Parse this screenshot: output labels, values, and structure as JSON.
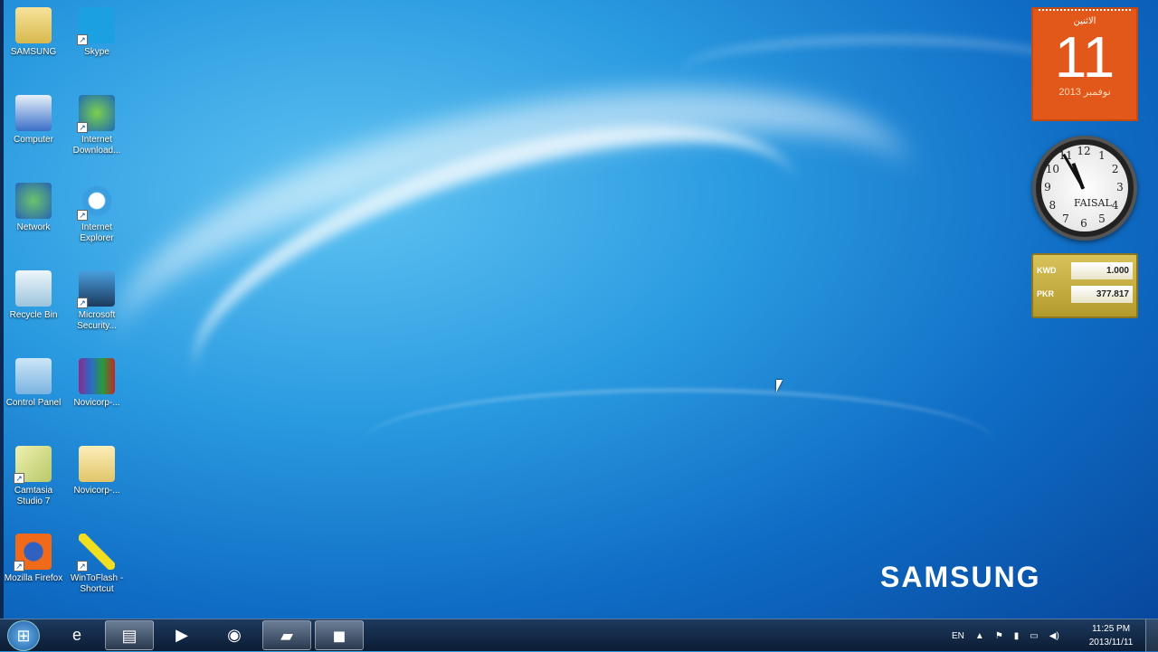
{
  "desktop_icons": [
    {
      "label": "SAMSUNG",
      "icon": "user-folder-icon",
      "shortcut": false
    },
    {
      "label": "Skype",
      "icon": "skype-icon",
      "shortcut": true
    },
    {
      "label": "Computer",
      "icon": "computer-icon",
      "shortcut": false
    },
    {
      "label": "Internet Download...",
      "icon": "idm-icon",
      "shortcut": true
    },
    {
      "label": "Network",
      "icon": "network-icon",
      "shortcut": false
    },
    {
      "label": "Internet Explorer",
      "icon": "ie-icon",
      "shortcut": true
    },
    {
      "label": "Recycle Bin",
      "icon": "recycle-bin-icon",
      "shortcut": false
    },
    {
      "label": "Microsoft Security...",
      "icon": "security-icon",
      "shortcut": true
    },
    {
      "label": "Control Panel",
      "icon": "control-panel-icon",
      "shortcut": false
    },
    {
      "label": "Novicorp-...",
      "icon": "winrar-icon",
      "shortcut": false
    },
    {
      "label": "Camtasia Studio 7",
      "icon": "camtasia-icon",
      "shortcut": true
    },
    {
      "label": "Novicorp-...",
      "icon": "folder-icon",
      "shortcut": false
    },
    {
      "label": "Mozilla Firefox",
      "icon": "firefox-icon",
      "shortcut": true
    },
    {
      "label": "WinToFlash - Shortcut",
      "icon": "wintoflash-icon",
      "shortcut": true
    }
  ],
  "calendar": {
    "weekday": "الاثنين",
    "day": "11",
    "month_year": "نوفمبر 2013"
  },
  "clock": {
    "brand": "FAISAL",
    "numbers": [
      "12",
      "1",
      "2",
      "3",
      "4",
      "5",
      "6",
      "7",
      "8",
      "9",
      "10",
      "11"
    ]
  },
  "currency": {
    "rows": [
      {
        "code": "KWD",
        "value": "1.000"
      },
      {
        "code": "PKR",
        "value": "377.817"
      }
    ]
  },
  "brand": "SAMSUNG",
  "taskbar": {
    "start": "⊞",
    "items": [
      {
        "name": "internet-explorer",
        "glyph": "e",
        "active": false
      },
      {
        "name": "windows-explorer",
        "glyph": "▤",
        "active": true
      },
      {
        "name": "media-player",
        "glyph": "▶",
        "active": false
      },
      {
        "name": "firefox",
        "glyph": "◉",
        "active": false
      },
      {
        "name": "camtasia",
        "glyph": "▰",
        "active": true
      },
      {
        "name": "camtasia-recorder",
        "glyph": "◼",
        "active": true
      }
    ]
  },
  "tray": {
    "language": "EN",
    "show_hidden": "▲",
    "flag": "⚑",
    "power": "▮",
    "network": "▭",
    "volume": "◀)",
    "time": "11:25 PM",
    "date": "2013/11/11"
  }
}
